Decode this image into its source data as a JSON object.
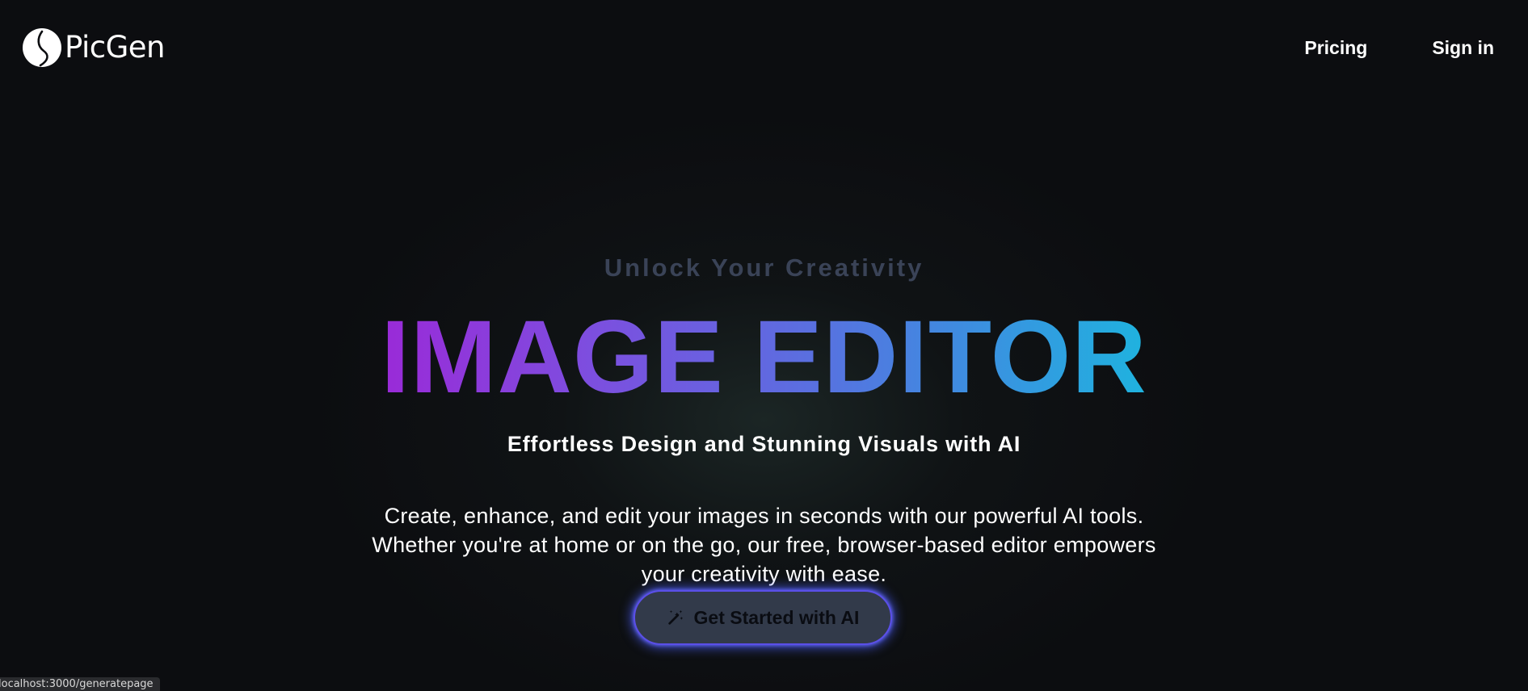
{
  "header": {
    "brand": "PicGen",
    "brand_icon": "leaf-logo-icon",
    "nav": [
      {
        "label": "Pricing"
      },
      {
        "label": "Sign in"
      }
    ]
  },
  "hero": {
    "eyebrow": "Unlock Your Creativity",
    "headline": "IMAGE EDITOR",
    "subheadline": "Effortless Design and Stunning Visuals with AI",
    "description": "Create, enhance, and edit your images in seconds with our powerful AI tools. Whether you're at home or on the go, our free, browser-based editor empowers your creativity with ease.",
    "cta": {
      "label": "Get Started with AI",
      "icon": "magic-wand-icon"
    }
  },
  "status_bar": {
    "url": "localhost:3000/generatepage"
  },
  "colors": {
    "background": "#0c0d10",
    "eyebrow": "#3a4357",
    "gradient_start": "#9a2ad8",
    "gradient_end": "#1fb3df",
    "cta_background": "#323a4a",
    "cta_glow": "#5b4fe8"
  }
}
